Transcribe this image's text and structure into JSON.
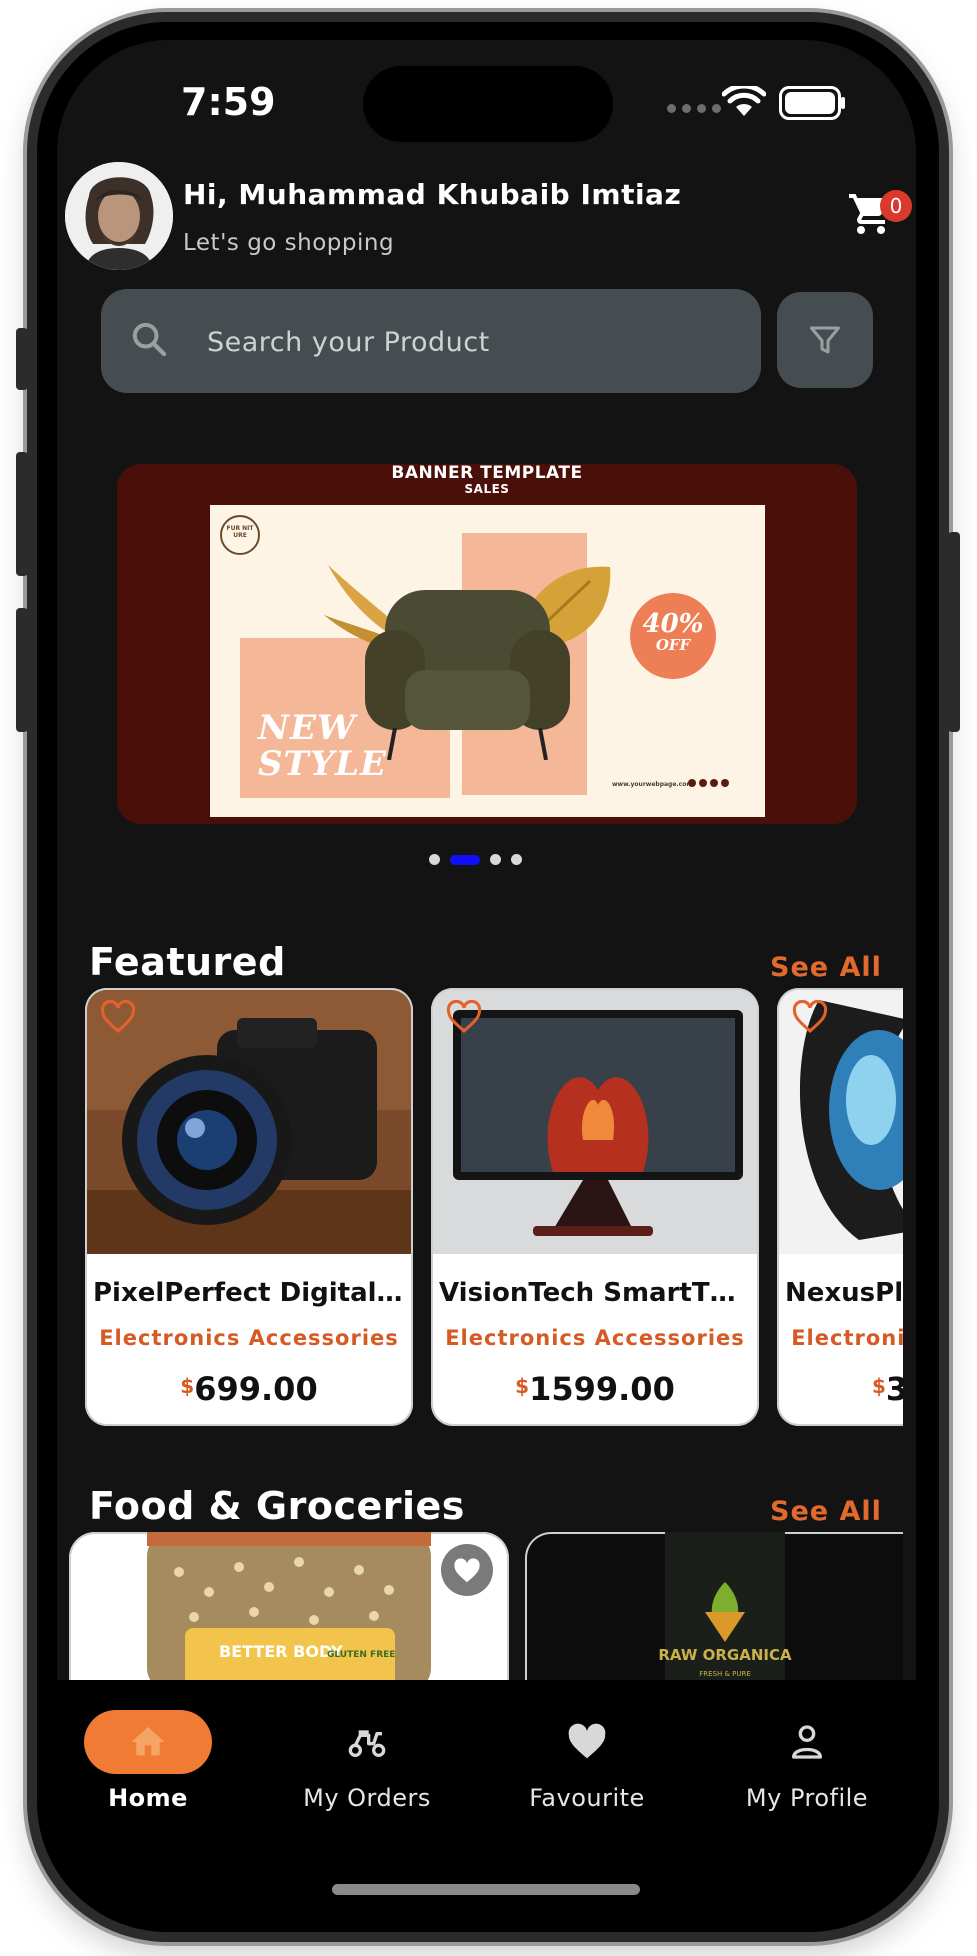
{
  "status_bar": {
    "time": "7:59"
  },
  "header": {
    "greeting": "Hi, Muhammad Khubaib Imtiaz",
    "subtitle": "Let's go shopping",
    "cart_count": "0"
  },
  "search": {
    "placeholder": "Search your Product"
  },
  "banner": {
    "title": "BANNER TEMPLATE",
    "subtitle": "SALES",
    "logo_text": "FUR NIT URE",
    "headline_line1": "NEW",
    "headline_line2": "STYLE",
    "discount_pct": "40%",
    "discount_label": "OFF",
    "url": "www.yourwebpage.com",
    "page_count": 4,
    "active_page": 2
  },
  "sections": {
    "featured": {
      "title": "Featured",
      "see_all": "See All"
    },
    "food": {
      "title": "Food & Groceries",
      "see_all": "See All"
    }
  },
  "featured_products": [
    {
      "name": "PixelPerfect Digital Camera",
      "category": "Electronics Accessories",
      "currency": "$",
      "price": "699.00"
    },
    {
      "name": "VisionTech SmartTV Monitor",
      "category": "Electronics Accessories",
      "currency": "$",
      "price": "1599.00"
    },
    {
      "name": "NexusPlay VR Headset",
      "category": "Electronics Accessories",
      "currency": "$",
      "price": "3"
    }
  ],
  "food_products": [
    {
      "brand": "BETTER BODY",
      "badge": "GLUTEN FREE"
    },
    {
      "brand": "RAW ORGANICA",
      "tagline": "FRESH & PURE"
    }
  ],
  "bottom_nav": [
    {
      "label": "Home",
      "icon": "home-icon",
      "active": true
    },
    {
      "label": "My Orders",
      "icon": "scooter-icon",
      "active": false
    },
    {
      "label": "Favourite",
      "icon": "heart-icon",
      "active": false
    },
    {
      "label": "My Profile",
      "icon": "person-icon",
      "active": false
    }
  ],
  "colors": {
    "accent": "#ef7b35",
    "category_text": "#d55a23",
    "background": "#131313",
    "search_bg": "#464d50",
    "badge": "#d93a2b",
    "pager_active": "#1010ff"
  }
}
